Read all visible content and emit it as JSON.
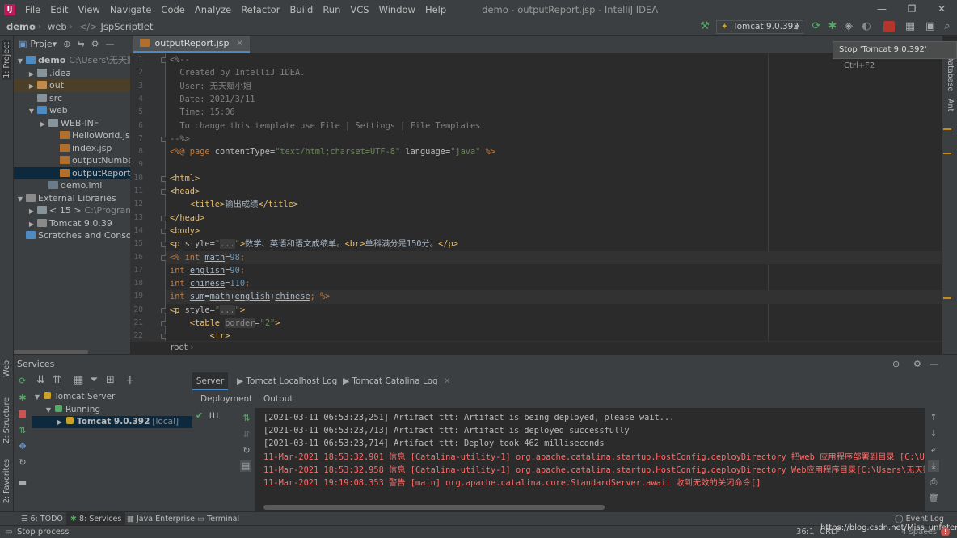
{
  "window": {
    "title": "demo - outputReport.jsp - IntelliJ IDEA",
    "menu": [
      "File",
      "Edit",
      "View",
      "Navigate",
      "Code",
      "Analyze",
      "Refactor",
      "Build",
      "Run",
      "VCS",
      "Window",
      "Help"
    ],
    "controls": {
      "minimize": "—",
      "maximize": "❐",
      "close": "✕"
    }
  },
  "navbar": {
    "crumbs": [
      "demo",
      "web",
      "JspScriptlet"
    ],
    "run_config": "Tomcat 9.0.392"
  },
  "tooltip": {
    "text": "Stop 'Tomcat 9.0.392'",
    "shortcut": "Ctrl+F2"
  },
  "left_strip": {
    "project": "1: Project",
    "web": "Web",
    "structure": "Z: Structure",
    "favorites": "2: Favorites"
  },
  "right_strip": {
    "database": "Database",
    "ant": "Ant"
  },
  "project": {
    "header": "Proje▾",
    "tree": [
      {
        "label": "demo",
        "suffix": "C:\\Users\\无天赋小姐",
        "indent": 0,
        "arrow": "▼",
        "icon": "ic-folder-b",
        "bold": true
      },
      {
        "label": ".idea",
        "indent": 1,
        "arrow": "▶",
        "icon": "ic-folder"
      },
      {
        "label": "out",
        "indent": 1,
        "arrow": "▶",
        "icon": "ic-folder-o",
        "cls": "out"
      },
      {
        "label": "src",
        "indent": 1,
        "arrow": "",
        "icon": "ic-folder"
      },
      {
        "label": "web",
        "indent": 1,
        "arrow": "▼",
        "icon": "ic-folder-b"
      },
      {
        "label": "WEB-INF",
        "indent": 2,
        "arrow": "▶",
        "icon": "ic-folder"
      },
      {
        "label": "HelloWorld.jsp",
        "indent": 3,
        "arrow": "",
        "icon": "ic-jsp"
      },
      {
        "label": "index.jsp",
        "indent": 3,
        "arrow": "",
        "icon": "ic-jsp"
      },
      {
        "label": "outputNumber.jsp",
        "indent": 3,
        "arrow": "",
        "icon": "ic-jsp"
      },
      {
        "label": "outputReport.jsp",
        "indent": 3,
        "arrow": "",
        "icon": "ic-jsp",
        "cls": "sel"
      },
      {
        "label": "demo.iml",
        "indent": 2,
        "arrow": "",
        "icon": "ic-iml"
      },
      {
        "label": "External Libraries",
        "indent": 0,
        "arrow": "▼",
        "icon": "ic-lib"
      },
      {
        "label": "< 15 >",
        "suffix": "C:\\Program File",
        "indent": 1,
        "arrow": "▶",
        "icon": "ic-folder"
      },
      {
        "label": "Tomcat 9.0.39",
        "indent": 1,
        "arrow": "▶",
        "icon": "ic-lib"
      },
      {
        "label": "Scratches and Consoles",
        "indent": 0,
        "arrow": "",
        "icon": "ic-folder-b"
      }
    ]
  },
  "editor": {
    "tab": "outputReport.jsp",
    "breadcrumb": "root",
    "lines": [
      [
        [
          "c-cmt",
          "<%--"
        ]
      ],
      [
        [
          "c-cmt",
          "  Created by IntelliJ IDEA."
        ]
      ],
      [
        [
          "c-cmt",
          "  User: 无天赋小姐"
        ]
      ],
      [
        [
          "c-cmt",
          "  Date: 2021/3/11"
        ]
      ],
      [
        [
          "c-cmt",
          "  Time: 15:06"
        ]
      ],
      [
        [
          "c-cmt",
          "  To change this template use File | Settings | File Templates."
        ]
      ],
      [
        [
          "c-cmt",
          "--%>"
        ]
      ],
      [
        [
          "c-kw",
          "<%@ page "
        ],
        [
          "c-attr",
          "contentType="
        ],
        [
          "c-str",
          "\"text/html;charset=UTF-8\""
        ],
        [
          "c-attr",
          " language="
        ],
        [
          "c-str",
          "\"java\""
        ],
        [
          "c-kw",
          " %>"
        ]
      ],
      [
        [
          "",
          ""
        ]
      ],
      [
        [
          "c-tag",
          "<html>"
        ]
      ],
      [
        [
          "c-tag",
          "<head>"
        ]
      ],
      [
        [
          "",
          "    "
        ],
        [
          "c-tag",
          "<title>"
        ],
        [
          "",
          "输出成绩"
        ],
        [
          "c-tag",
          "</title>"
        ]
      ],
      [
        [
          "c-tag",
          "</head>"
        ]
      ],
      [
        [
          "c-tag",
          "<body>"
        ]
      ],
      [
        [
          "c-tag",
          "<p "
        ],
        [
          "c-attr",
          "style="
        ],
        [
          "c-str",
          "\""
        ],
        [
          "c-fold",
          "..."
        ],
        [
          "c-str",
          "\""
        ],
        [
          "c-tag",
          ">"
        ],
        [
          "",
          "数学、英语和语文成绩单。"
        ],
        [
          "c-tag",
          "<br>"
        ],
        [
          "",
          "单科满分是150分。"
        ],
        [
          "c-tag",
          "</p>"
        ]
      ],
      [
        [
          "c-kw",
          "<% int "
        ],
        [
          "c-var",
          "math"
        ],
        [
          "",
          "="
        ],
        [
          "c-num",
          "98"
        ],
        [
          "c-kw",
          ";"
        ]
      ],
      [
        [
          "c-kw",
          "int "
        ],
        [
          "c-var",
          "english"
        ],
        [
          "",
          "="
        ],
        [
          "c-num",
          "90"
        ],
        [
          "c-kw",
          ";"
        ]
      ],
      [
        [
          "c-kw",
          "int "
        ],
        [
          "c-var",
          "chinese"
        ],
        [
          "",
          "="
        ],
        [
          "c-num",
          "110"
        ],
        [
          "c-kw",
          ";"
        ]
      ],
      [
        [
          "c-kw",
          "int "
        ],
        [
          "c-var",
          "sum"
        ],
        [
          "",
          "="
        ],
        [
          "c-var",
          "math"
        ],
        [
          "",
          "+"
        ],
        [
          "c-var",
          "english"
        ],
        [
          "",
          "+"
        ],
        [
          "c-var",
          "chinese"
        ],
        [
          "c-kw",
          "; %>"
        ]
      ],
      [
        [
          "c-tag",
          "<p "
        ],
        [
          "c-attr",
          "style="
        ],
        [
          "c-str",
          "\""
        ],
        [
          "c-fold",
          "..."
        ],
        [
          "c-str",
          "\""
        ],
        [
          "c-tag",
          ">"
        ]
      ],
      [
        [
          "",
          "    "
        ],
        [
          "c-tag",
          "<table "
        ],
        [
          "c-fold",
          "border"
        ],
        [
          "c-attr",
          "="
        ],
        [
          "c-str",
          "\"2\""
        ],
        [
          "c-tag",
          ">"
        ]
      ],
      [
        [
          "",
          "        "
        ],
        [
          "c-tag",
          "<tr>"
        ]
      ]
    ]
  },
  "services": {
    "title": "Services",
    "tree": [
      {
        "label": "Tomcat Server",
        "indent": 0,
        "arrow": "▼",
        "icon": "#c9a227"
      },
      {
        "label": "Running",
        "indent": 1,
        "arrow": "▼",
        "icon": "#59a869"
      },
      {
        "label": "Tomcat 9.0.392",
        "suffix": "[local]",
        "indent": 2,
        "arrow": "▶",
        "icon": "#c9a227",
        "sel": true
      }
    ],
    "tabs": [
      "Server",
      "Tomcat Localhost Log",
      "Tomcat Catalina Log"
    ],
    "deployment_header": "Deployment",
    "output_header": "Output",
    "deploy_item": "ttt",
    "console": [
      {
        "cls": "con-w",
        "text": "[2021-03-11 06:53:23,251] Artifact ttt: Artifact is being deployed, please wait..."
      },
      {
        "cls": "con-w",
        "text": "[2021-03-11 06:53:23,713] Artifact ttt: Artifact is deployed successfully"
      },
      {
        "cls": "con-w",
        "text": "[2021-03-11 06:53:23,714] Artifact ttt: Deploy took 462 milliseconds"
      },
      {
        "cls": "con-r",
        "text": "11-Mar-2021 18:53:32.901 信息 [Catalina-utility-1] org.apache.catalina.startup.HostConfig.deployDirectory 把web 应用程序部署到目录 [C:\\Use"
      },
      {
        "cls": "con-r",
        "text": "11-Mar-2021 18:53:32.958 信息 [Catalina-utility-1] org.apache.catalina.startup.HostConfig.deployDirectory Web应用程序目录[C:\\Users\\无天赋"
      },
      {
        "cls": "con-r",
        "text": "11-Mar-2021 19:19:08.353 警告 [main] org.apache.catalina.core.StandardServer.await 收到无效的关闭命令[]"
      }
    ]
  },
  "bottom_tabs": [
    "6: TODO",
    "8: Services",
    "Java Enterprise",
    "Terminal"
  ],
  "event_log": "Event Log",
  "status": {
    "left": "Stop process",
    "position": "36:1",
    "encoding": "CRLF",
    "watermark": "https://blog.csdn.net/Miss_unfatented",
    "indent": "4 spaces"
  }
}
